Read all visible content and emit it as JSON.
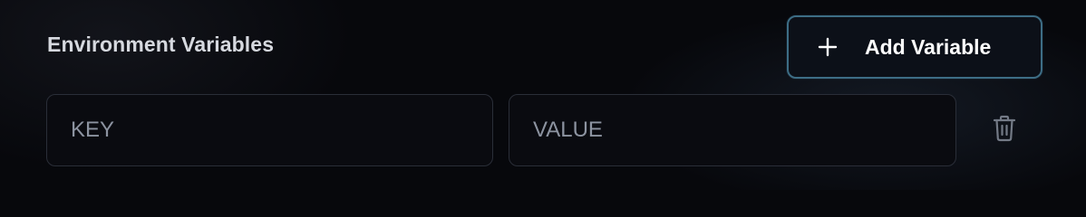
{
  "section": {
    "title": "Environment Variables"
  },
  "toolbar": {
    "add_label": "Add Variable",
    "add_icon": "plus-icon"
  },
  "variables": [
    {
      "key_placeholder": "KEY",
      "key_value": "",
      "value_placeholder": "VALUE",
      "value_value": "",
      "delete_icon": "trash-icon"
    }
  ],
  "colors": {
    "background": "#07080c",
    "accent_border": "#3d6d85",
    "title_text": "#d6d9df",
    "placeholder_text": "#8c93a0"
  }
}
